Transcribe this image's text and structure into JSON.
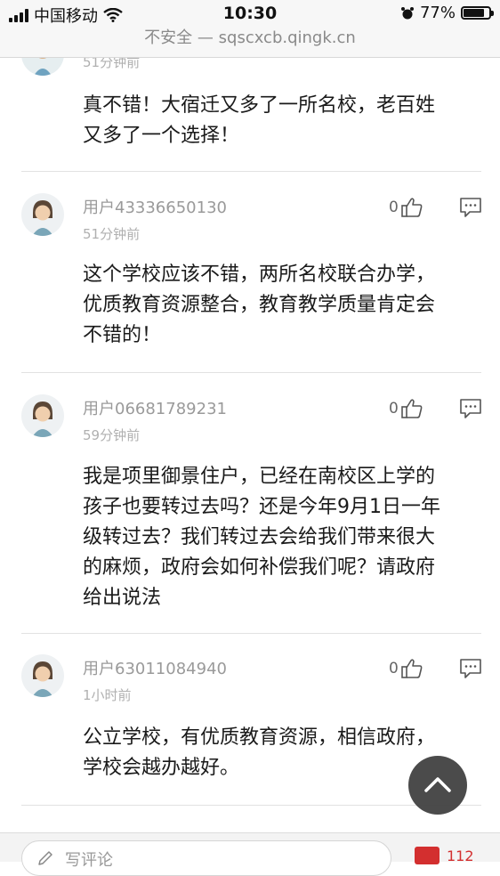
{
  "status_bar": {
    "carrier": "中国移动",
    "time": "10:30",
    "battery": "77%",
    "battery_level": 0.77
  },
  "url_bar": {
    "security": "不安全",
    "separator": "—",
    "domain": "sqscxcb.qingk.cn"
  },
  "first_comment": {
    "time": "51分钟前",
    "text_line1": "真不错！大宿迁又多了一所名校，老百姓",
    "text_line2": "又多了一个选择！"
  },
  "comments": [
    {
      "username": "用户43336650130",
      "time": "51分钟前",
      "likes": "0",
      "lines": [
        "这个学校应该不错，两所名校联合办学，",
        "优质教育资源整合，教育教学质量肯定会",
        "不错的！"
      ]
    },
    {
      "username": "用户06681789231",
      "time": "59分钟前",
      "likes": "0",
      "lines": [
        "我是项里御景住户，已经在南校区上学的",
        "孩子也要转过去吗？还是今年9月1日一年",
        "级转过去？我们转过去会给我们带来很大",
        "的麻烦，政府会如何补偿我们呢？请政府",
        "给出说法"
      ]
    },
    {
      "username": "用户63011084940",
      "time": "1小时前",
      "likes": "0",
      "lines": [
        "公立学校，有优质教育资源，相信政府，",
        "学校会越办越好。"
      ]
    }
  ],
  "bottom_bar": {
    "input_placeholder": "写评论",
    "comment_count": "112"
  },
  "icons": {
    "like": "thumbs-up-icon",
    "reply": "comment-bubble-icon",
    "scroll_top": "chevron-up-icon",
    "pen": "pen-icon",
    "comment_count": "comment-count-icon"
  },
  "colors": {
    "accent": "#d32f2f",
    "text": "#1a1a1a",
    "muted": "#9a9a9a"
  }
}
